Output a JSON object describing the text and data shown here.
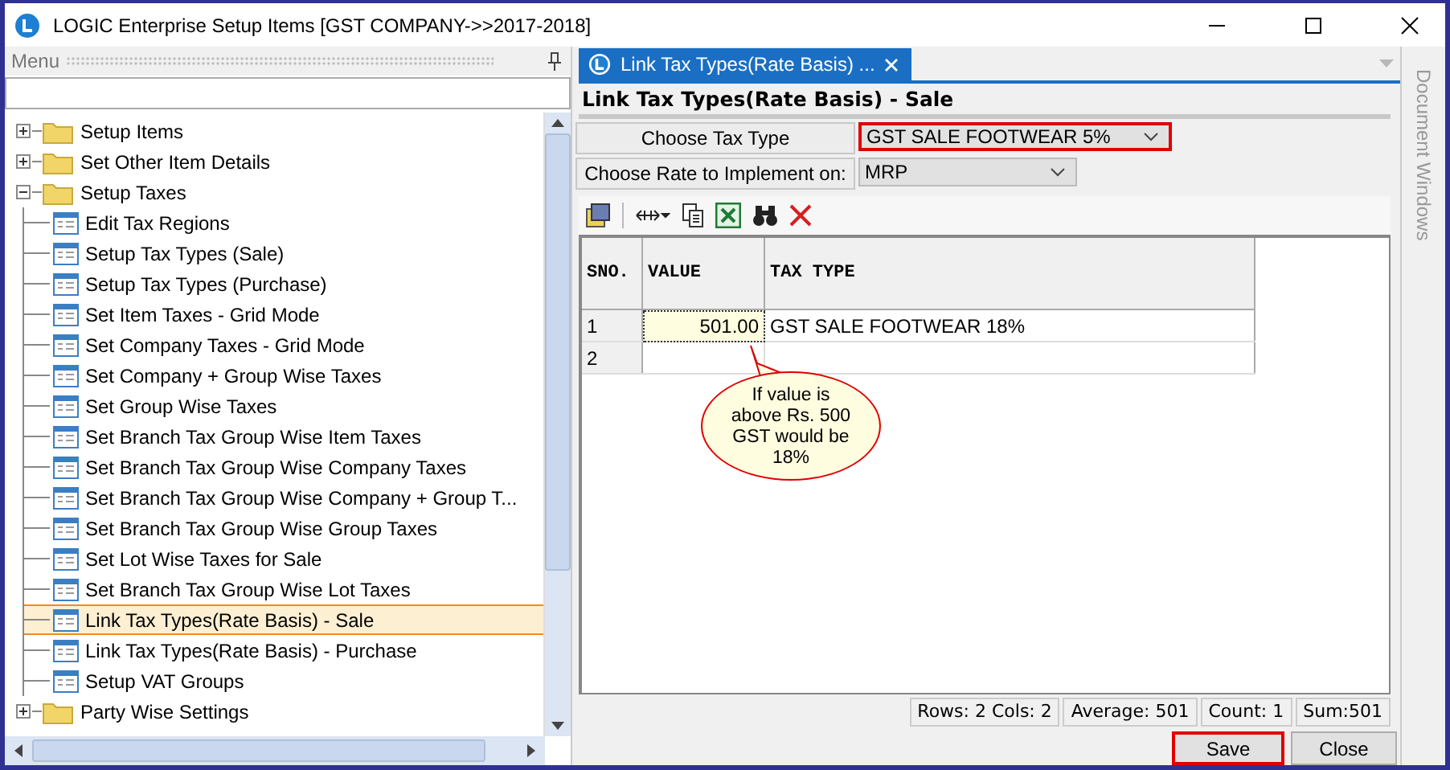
{
  "window": {
    "title": "LOGIC Enterprise Setup Items  [GST COMPANY->>2017-2018]"
  },
  "menu": {
    "title": "Menu",
    "tree": [
      {
        "label": "Setup Items",
        "kind": "folder",
        "expanded": false,
        "selected": false
      },
      {
        "label": "Set Other Item Details",
        "kind": "folder",
        "expanded": false,
        "selected": false
      },
      {
        "label": "Setup Taxes",
        "kind": "folder",
        "expanded": true,
        "selected": false,
        "children": [
          {
            "label": "Edit Tax Regions",
            "kind": "form",
            "selected": false
          },
          {
            "label": "Setup Tax Types (Sale)",
            "kind": "form",
            "selected": false
          },
          {
            "label": "Setup Tax Types (Purchase)",
            "kind": "form",
            "selected": false
          },
          {
            "label": "Set Item Taxes - Grid Mode",
            "kind": "form",
            "selected": false
          },
          {
            "label": "Set Company Taxes - Grid Mode",
            "kind": "form",
            "selected": false
          },
          {
            "label": "Set Company + Group Wise Taxes",
            "kind": "form",
            "selected": false
          },
          {
            "label": "Set Group Wise Taxes",
            "kind": "form",
            "selected": false
          },
          {
            "label": "Set Branch Tax Group Wise Item Taxes",
            "kind": "form",
            "selected": false
          },
          {
            "label": "Set Branch Tax Group Wise Company Taxes",
            "kind": "form",
            "selected": false
          },
          {
            "label": "Set Branch Tax Group Wise Company + Group T...",
            "kind": "form",
            "selected": false
          },
          {
            "label": "Set Branch Tax Group Wise Group Taxes",
            "kind": "form",
            "selected": false
          },
          {
            "label": "Set Lot Wise Taxes for Sale",
            "kind": "form",
            "selected": false
          },
          {
            "label": "Set Branch Tax Group Wise Lot Taxes",
            "kind": "form",
            "selected": false
          },
          {
            "label": "Link Tax Types(Rate Basis) - Sale",
            "kind": "form",
            "selected": true
          },
          {
            "label": "Link Tax Types(Rate Basis) - Purchase",
            "kind": "form",
            "selected": false
          },
          {
            "label": "Setup VAT Groups",
            "kind": "form",
            "selected": false
          }
        ]
      },
      {
        "label": "Party Wise Settings",
        "kind": "folder",
        "expanded": false,
        "selected": false
      }
    ]
  },
  "document": {
    "tab": "Link Tax Types(Rate Basis) ...",
    "heading": "Link Tax Types(Rate Basis) - Sale",
    "fields": [
      {
        "label": "Choose Tax Type",
        "value": "GST SALE FOOTWEAR 5%",
        "highlighted": true
      },
      {
        "label": "Choose Rate to Implement on:",
        "value": "MRP",
        "highlighted": false
      }
    ],
    "table": {
      "columns": [
        "SNO.",
        "VALUE",
        "TAX TYPE"
      ],
      "rows": [
        {
          "cells": [
            "1",
            "501.00",
            "GST SALE FOOTWEAR 18%"
          ],
          "selected": true
        },
        {
          "cells": [
            "2",
            "",
            ""
          ],
          "selected": false
        }
      ]
    },
    "callout": "If value is above Rs. 500 GST would be 18%",
    "status_bar": [
      "Rows: 2  Cols: 2",
      "Average: 501",
      "Count: 1",
      "Sum:501"
    ],
    "buttons": [
      {
        "label": "Save",
        "highlighted": true
      },
      {
        "label": "Close",
        "highlighted": false
      }
    ]
  },
  "side_panel": {
    "title": "Document Windows"
  }
}
